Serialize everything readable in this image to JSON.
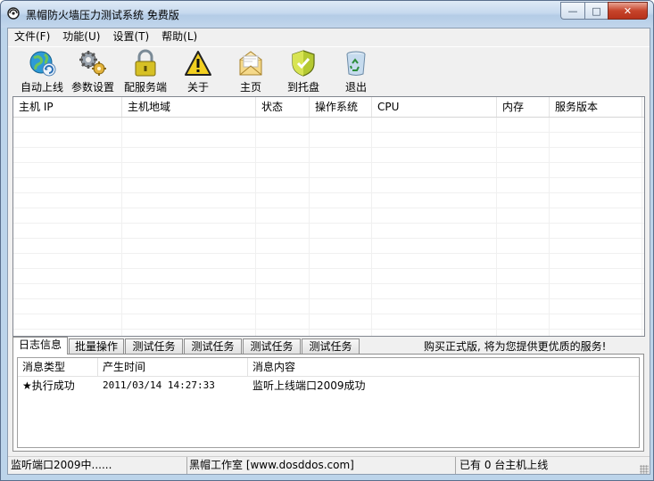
{
  "window": {
    "title": "黑帽防火墙压力测试系统 免费版"
  },
  "menu": [
    "文件(F)",
    "功能(U)",
    "设置(T)",
    "帮助(L)"
  ],
  "toolbar": [
    {
      "label": "自动上线",
      "icon": "globe-refresh-icon"
    },
    {
      "label": "参数设置",
      "icon": "gears-icon"
    },
    {
      "label": "配服务端",
      "icon": "lock-icon"
    },
    {
      "label": "关于",
      "icon": "warning-icon"
    },
    {
      "label": "主页",
      "icon": "envelope-icon"
    },
    {
      "label": "到托盘",
      "icon": "shield-icon"
    },
    {
      "label": "退出",
      "icon": "recycle-bin-icon"
    }
  ],
  "host_table": {
    "columns": [
      "主机 IP",
      "主机地域",
      "状态",
      "操作系统",
      "CPU",
      "内存",
      "服务版本"
    ],
    "rows": []
  },
  "tabs": [
    "日志信息",
    "批量操作",
    "测试任务1",
    "测试任务2",
    "测试任务3",
    "测试任务4"
  ],
  "promo": "购买正式版, 将为您提供更优质的服务!",
  "log": {
    "columns": [
      "消息类型",
      "产生时间",
      "消息内容"
    ],
    "rows": [
      {
        "type": "★执行成功",
        "time": "2011/03/14 14:27:33",
        "content": "监听上线端口2009成功"
      }
    ]
  },
  "status": {
    "left": "监听端口2009中......",
    "center": "黑帽工作室 [www.dosddos.com]",
    "right": "已有 0 台主机上线"
  }
}
